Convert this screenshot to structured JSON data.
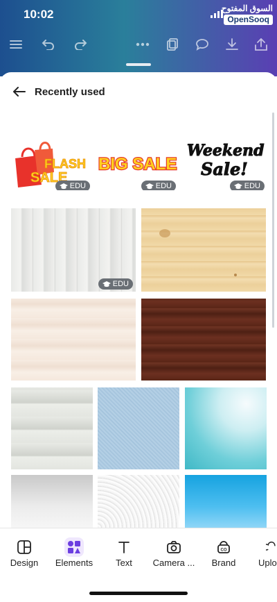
{
  "status": {
    "time": "10:02"
  },
  "watermark": {
    "arabic": "السوق المفتوح",
    "brand": "OpenSooq"
  },
  "sheet": {
    "title": "Recently used"
  },
  "badges": {
    "edu": "EDU"
  },
  "stickers": {
    "flash_sale": "FLASH SALE",
    "big_sale": "BIG SALE",
    "weekend_line1": "Weekend",
    "weekend_line2": "Sale!"
  },
  "bottom_nav": [
    {
      "label": "Design",
      "icon": "design-icon"
    },
    {
      "label": "Elements",
      "icon": "elements-icon",
      "active": true
    },
    {
      "label": "Text",
      "icon": "text-icon"
    },
    {
      "label": "Camera ...",
      "icon": "camera-icon"
    },
    {
      "label": "Brand",
      "icon": "brand-icon"
    },
    {
      "label": "Uplo",
      "icon": "upload-icon"
    }
  ],
  "colors": {
    "accent": "#7d2ae8",
    "header_start": "#1d4f8f",
    "header_end": "#5a3fb3"
  }
}
